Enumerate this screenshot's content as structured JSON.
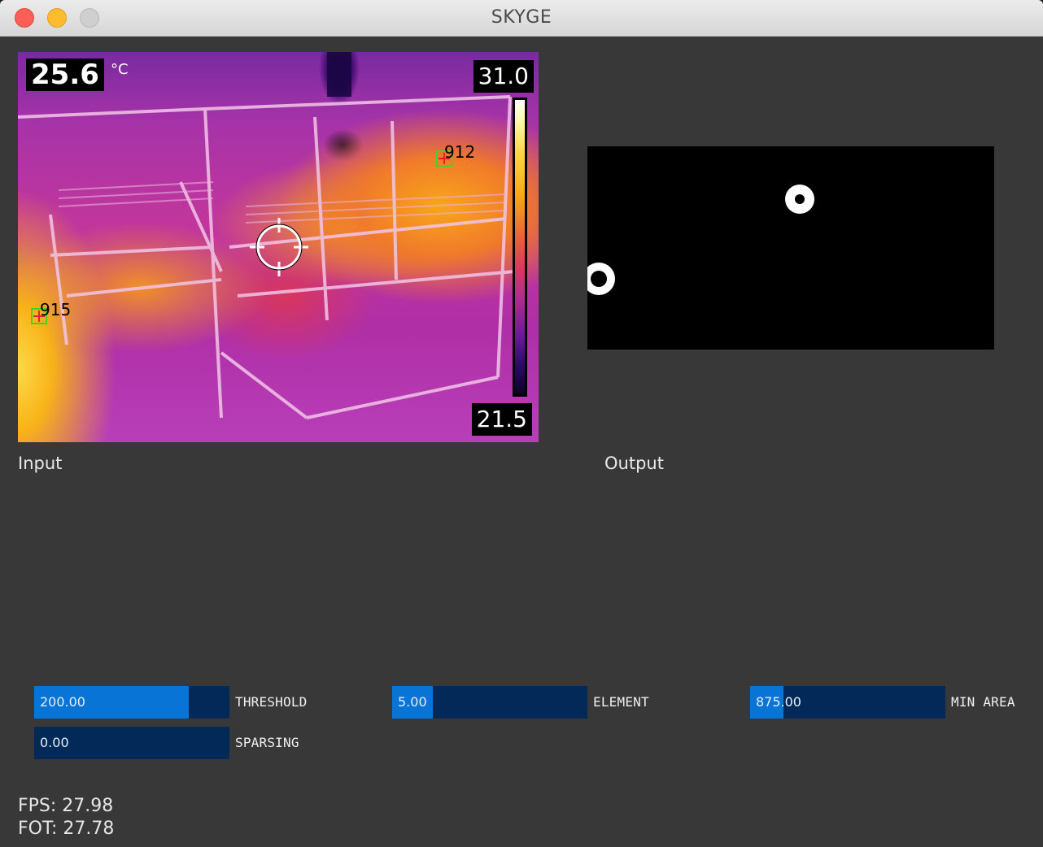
{
  "window": {
    "title": "SKYGE"
  },
  "input": {
    "label": "Input",
    "current_temp": "25.6",
    "temp_unit": "°C",
    "scale_max": "31.0",
    "scale_min": "21.5",
    "spots": [
      {
        "label": "912"
      },
      {
        "label": "915"
      }
    ],
    "icons": [
      "crosshair-icon",
      "spot-marker-icon"
    ]
  },
  "output": {
    "label": "Output",
    "blobs": 2
  },
  "controls": {
    "threshold": {
      "label": "THRESHOLD",
      "value": "200.00",
      "fraction": 0.79
    },
    "element": {
      "label": "ELEMENT",
      "value": "5.00",
      "fraction": 0.21
    },
    "min_area": {
      "label": "MIN AREA",
      "value": "875.00",
      "fraction": 0.17
    },
    "sparsing": {
      "label": "SPARSING",
      "value": "0.00",
      "fraction": 0.0
    }
  },
  "stats": {
    "fps": "FPS: 27.98",
    "fot": "FOT: 27.78"
  },
  "colors": {
    "slider_fill": "#0874d6",
    "slider_track": "#022957",
    "background": "#383838",
    "close": "#fc5f57",
    "minimize": "#fdbc2e",
    "zoom": "#cfcfcf"
  }
}
